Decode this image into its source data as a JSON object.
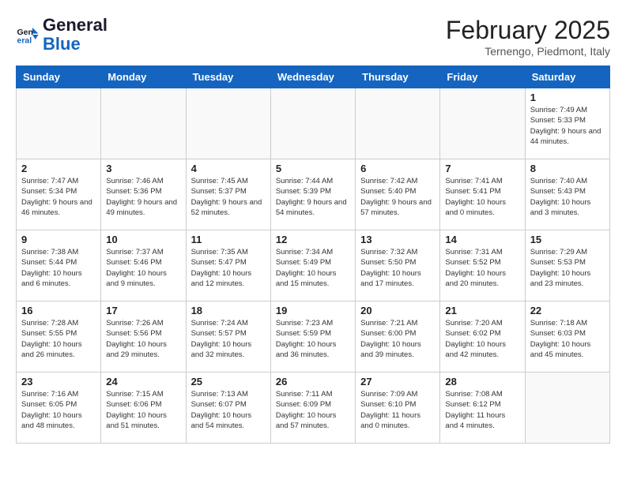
{
  "logo": {
    "text_general": "General",
    "text_blue": "Blue"
  },
  "header": {
    "month": "February 2025",
    "location": "Ternengo, Piedmont, Italy"
  },
  "weekdays": [
    "Sunday",
    "Monday",
    "Tuesday",
    "Wednesday",
    "Thursday",
    "Friday",
    "Saturday"
  ],
  "weeks": [
    [
      {
        "day": "",
        "info": ""
      },
      {
        "day": "",
        "info": ""
      },
      {
        "day": "",
        "info": ""
      },
      {
        "day": "",
        "info": ""
      },
      {
        "day": "",
        "info": ""
      },
      {
        "day": "",
        "info": ""
      },
      {
        "day": "1",
        "info": "Sunrise: 7:49 AM\nSunset: 5:33 PM\nDaylight: 9 hours and 44 minutes."
      }
    ],
    [
      {
        "day": "2",
        "info": "Sunrise: 7:47 AM\nSunset: 5:34 PM\nDaylight: 9 hours and 46 minutes."
      },
      {
        "day": "3",
        "info": "Sunrise: 7:46 AM\nSunset: 5:36 PM\nDaylight: 9 hours and 49 minutes."
      },
      {
        "day": "4",
        "info": "Sunrise: 7:45 AM\nSunset: 5:37 PM\nDaylight: 9 hours and 52 minutes."
      },
      {
        "day": "5",
        "info": "Sunrise: 7:44 AM\nSunset: 5:39 PM\nDaylight: 9 hours and 54 minutes."
      },
      {
        "day": "6",
        "info": "Sunrise: 7:42 AM\nSunset: 5:40 PM\nDaylight: 9 hours and 57 minutes."
      },
      {
        "day": "7",
        "info": "Sunrise: 7:41 AM\nSunset: 5:41 PM\nDaylight: 10 hours and 0 minutes."
      },
      {
        "day": "8",
        "info": "Sunrise: 7:40 AM\nSunset: 5:43 PM\nDaylight: 10 hours and 3 minutes."
      }
    ],
    [
      {
        "day": "9",
        "info": "Sunrise: 7:38 AM\nSunset: 5:44 PM\nDaylight: 10 hours and 6 minutes."
      },
      {
        "day": "10",
        "info": "Sunrise: 7:37 AM\nSunset: 5:46 PM\nDaylight: 10 hours and 9 minutes."
      },
      {
        "day": "11",
        "info": "Sunrise: 7:35 AM\nSunset: 5:47 PM\nDaylight: 10 hours and 12 minutes."
      },
      {
        "day": "12",
        "info": "Sunrise: 7:34 AM\nSunset: 5:49 PM\nDaylight: 10 hours and 15 minutes."
      },
      {
        "day": "13",
        "info": "Sunrise: 7:32 AM\nSunset: 5:50 PM\nDaylight: 10 hours and 17 minutes."
      },
      {
        "day": "14",
        "info": "Sunrise: 7:31 AM\nSunset: 5:52 PM\nDaylight: 10 hours and 20 minutes."
      },
      {
        "day": "15",
        "info": "Sunrise: 7:29 AM\nSunset: 5:53 PM\nDaylight: 10 hours and 23 minutes."
      }
    ],
    [
      {
        "day": "16",
        "info": "Sunrise: 7:28 AM\nSunset: 5:55 PM\nDaylight: 10 hours and 26 minutes."
      },
      {
        "day": "17",
        "info": "Sunrise: 7:26 AM\nSunset: 5:56 PM\nDaylight: 10 hours and 29 minutes."
      },
      {
        "day": "18",
        "info": "Sunrise: 7:24 AM\nSunset: 5:57 PM\nDaylight: 10 hours and 32 minutes."
      },
      {
        "day": "19",
        "info": "Sunrise: 7:23 AM\nSunset: 5:59 PM\nDaylight: 10 hours and 36 minutes."
      },
      {
        "day": "20",
        "info": "Sunrise: 7:21 AM\nSunset: 6:00 PM\nDaylight: 10 hours and 39 minutes."
      },
      {
        "day": "21",
        "info": "Sunrise: 7:20 AM\nSunset: 6:02 PM\nDaylight: 10 hours and 42 minutes."
      },
      {
        "day": "22",
        "info": "Sunrise: 7:18 AM\nSunset: 6:03 PM\nDaylight: 10 hours and 45 minutes."
      }
    ],
    [
      {
        "day": "23",
        "info": "Sunrise: 7:16 AM\nSunset: 6:05 PM\nDaylight: 10 hours and 48 minutes."
      },
      {
        "day": "24",
        "info": "Sunrise: 7:15 AM\nSunset: 6:06 PM\nDaylight: 10 hours and 51 minutes."
      },
      {
        "day": "25",
        "info": "Sunrise: 7:13 AM\nSunset: 6:07 PM\nDaylight: 10 hours and 54 minutes."
      },
      {
        "day": "26",
        "info": "Sunrise: 7:11 AM\nSunset: 6:09 PM\nDaylight: 10 hours and 57 minutes."
      },
      {
        "day": "27",
        "info": "Sunrise: 7:09 AM\nSunset: 6:10 PM\nDaylight: 11 hours and 0 minutes."
      },
      {
        "day": "28",
        "info": "Sunrise: 7:08 AM\nSunset: 6:12 PM\nDaylight: 11 hours and 4 minutes."
      },
      {
        "day": "",
        "info": ""
      }
    ]
  ]
}
